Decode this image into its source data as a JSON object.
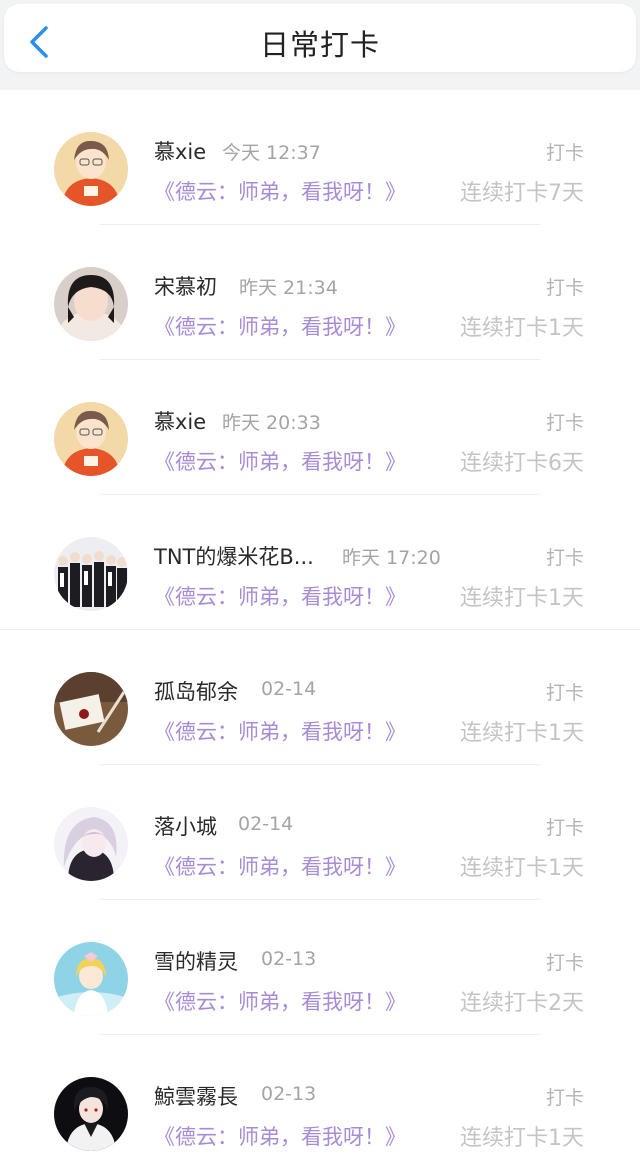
{
  "header": {
    "title": "日常打卡"
  },
  "colors": {
    "accent_purple": "#a88bd6",
    "back_blue": "#2a8ef0"
  },
  "entries": [
    {
      "name": "慕xie",
      "time": "今天 12:37",
      "action": "打卡",
      "book": "《德云：师弟，看我呀！》",
      "streak": "连续打卡7天",
      "avatar": "orange-hoodie-boy"
    },
    {
      "name": "宋慕初",
      "time": "昨天 21:34",
      "action": "打卡",
      "book": "《德云：师弟，看我呀！》",
      "streak": "连续打卡1天",
      "avatar": "girl-photo"
    },
    {
      "name": "慕xie",
      "time": "昨天 20:33",
      "action": "打卡",
      "book": "《德云：师弟，看我呀！》",
      "streak": "连续打卡6天",
      "avatar": "orange-hoodie-boy"
    },
    {
      "name": "TNT的爆米花B...",
      "time": "昨天 17:20",
      "action": "打卡",
      "book": "《德云：师弟，看我呀！》",
      "streak": "连续打卡1天",
      "avatar": "group-photo"
    },
    {
      "name": "孤岛郁余",
      "time": "02-14",
      "action": "打卡",
      "book": "《德云：师弟，看我呀！》",
      "streak": "连续打卡1天",
      "avatar": "letter-seal"
    },
    {
      "name": "落小城",
      "time": "02-14",
      "action": "打卡",
      "book": "《德云：师弟，看我呀！》",
      "streak": "连续打卡1天",
      "avatar": "anime-white-hair"
    },
    {
      "name": "雪的精灵",
      "time": "02-13",
      "action": "打卡",
      "book": "《德云：师弟，看我呀！》",
      "streak": "连续打卡2天",
      "avatar": "anime-blonde-girl"
    },
    {
      "name": "鯨雲霧長",
      "time": "02-13",
      "action": "打卡",
      "book": "《德云：师弟，看我呀！》",
      "streak": "连续打卡1天",
      "avatar": "anime-dark-boy"
    }
  ]
}
